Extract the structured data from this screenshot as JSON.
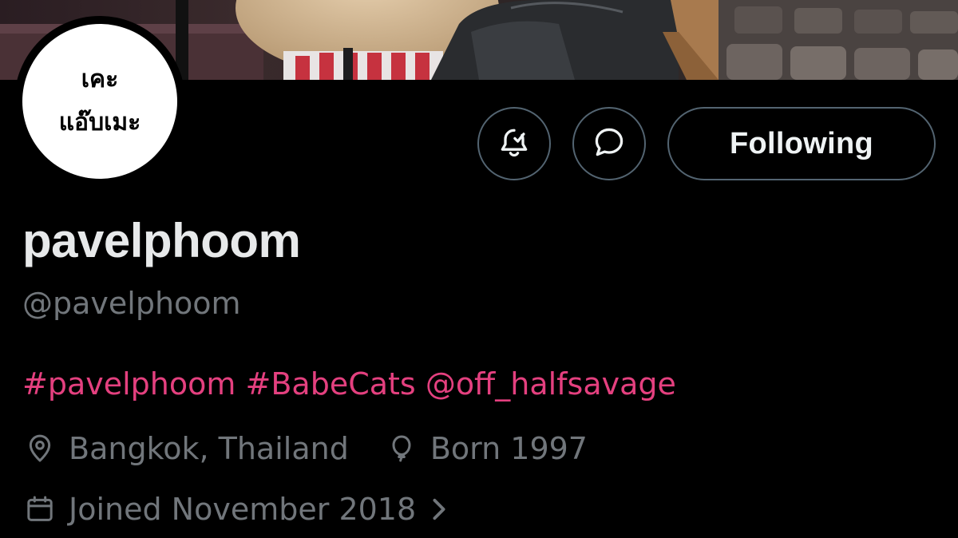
{
  "avatar": {
    "line1": "เคะ",
    "line2": "แอ๊บเมะ"
  },
  "actions": {
    "notify_icon": "bell-check-icon",
    "message_icon": "message-bubble-icon",
    "follow_label": "Following"
  },
  "profile": {
    "display_name": "pavelphoom",
    "handle": "@pavelphoom",
    "bio_links": [
      "#pavelphoom",
      "#BabeCats",
      "@off_halfsavage"
    ],
    "location": "Bangkok, Thailand",
    "birth": "Born 1997",
    "joined": "Joined November 2018"
  },
  "colors": {
    "background": "#000000",
    "text_primary": "#e7e9ea",
    "text_secondary": "#71767b",
    "link": "#e4407f",
    "button_border": "#536471"
  },
  "icons": {
    "location": "location-pin-icon",
    "birth": "balloon-icon",
    "joined": "calendar-icon",
    "more": "chevron-right-icon"
  }
}
